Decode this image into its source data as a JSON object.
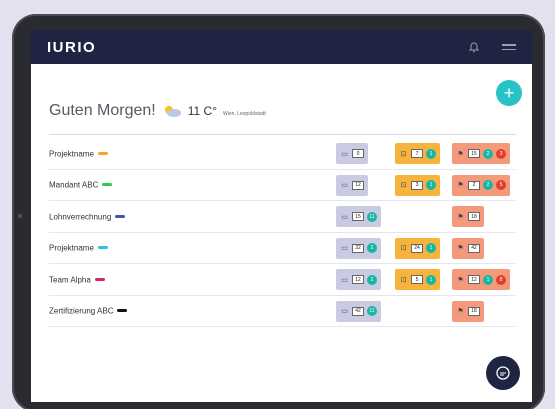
{
  "app": {
    "logo": "IURIO"
  },
  "header": {
    "greeting": "Guten Morgen!",
    "temperature": "11 C°",
    "location": "Wien, Leopoldstadt"
  },
  "colors": {
    "topbar": "#1f2442",
    "accent": "#27c3c5",
    "group1": "#c9cbe3",
    "group2": "#f7b33b",
    "group3": "#f29a7a"
  },
  "rows": [
    {
      "name": "Projektname",
      "tag_color": "#f5a623",
      "g1": {
        "count": "0",
        "dot": ""
      },
      "g2": {
        "count": "7",
        "dot": "1"
      },
      "g3": {
        "count": "15",
        "dot": "2",
        "dot2": "3"
      }
    },
    {
      "name": "Mandant ABC",
      "tag_color": "#2ecc40",
      "g1": {
        "count": "12",
        "dot": ""
      },
      "g2": {
        "count": "3",
        "dot": "1"
      },
      "g3": {
        "count": "2",
        "dot": "2",
        "dot2": "5"
      }
    },
    {
      "name": "Lohnverrechnung",
      "tag_color": "#4657b5",
      "g1": {
        "count": "15",
        "dot": "11"
      },
      "g2": null,
      "g3": {
        "count": "18",
        "dot": "",
        "dot2": ""
      }
    },
    {
      "name": "Projektname",
      "tag_color": "#2bc4d8",
      "g1": {
        "count": "32",
        "dot": "2"
      },
      "g2": {
        "count": "24",
        "dot": "1"
      },
      "g3": {
        "count": "42",
        "dot": "",
        "dot2": ""
      }
    },
    {
      "name": "Team Alpha",
      "tag_color": "#e0245e",
      "g1": {
        "count": "12",
        "dot": "2"
      },
      "g2": {
        "count": "5",
        "dot": "1"
      },
      "g3": {
        "count": "12",
        "dot": "1",
        "dot2": "8"
      }
    },
    {
      "name": "Zertifizierung ABC",
      "tag_color": "#111111",
      "g1": {
        "count": "42",
        "dot": "11"
      },
      "g2": null,
      "g3": {
        "count": "18",
        "dot": "",
        "dot2": ""
      }
    }
  ]
}
